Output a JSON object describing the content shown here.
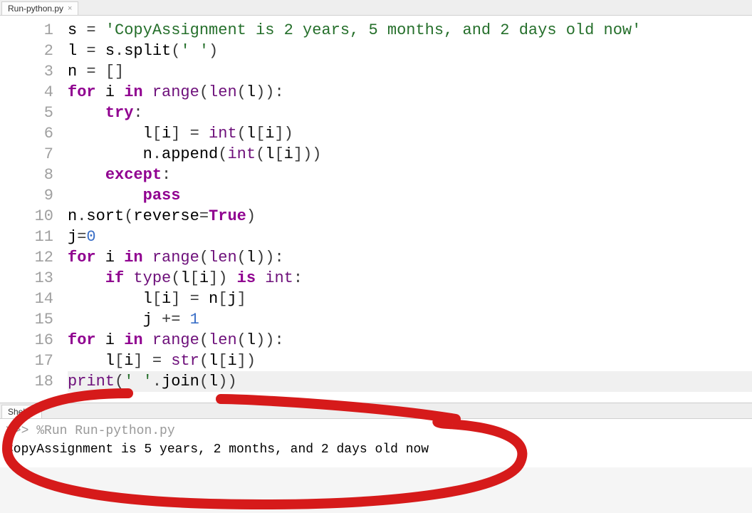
{
  "editor": {
    "tab_label": "Run-python.py",
    "lines": [
      {
        "n": 1,
        "tokens": [
          [
            "id",
            "s "
          ],
          [
            "op",
            "= "
          ],
          [
            "str",
            "'CopyAssignment is 2 years, 5 months, and 2 days old now'"
          ]
        ]
      },
      {
        "n": 2,
        "tokens": [
          [
            "id",
            "l "
          ],
          [
            "op",
            "= "
          ],
          [
            "id",
            "s"
          ],
          [
            "op",
            "."
          ],
          [
            "id",
            "split"
          ],
          [
            "paren",
            "("
          ],
          [
            "str",
            "' '"
          ],
          [
            "paren",
            ")"
          ]
        ]
      },
      {
        "n": 3,
        "tokens": [
          [
            "id",
            "n "
          ],
          [
            "op",
            "= "
          ],
          [
            "paren",
            "[]"
          ]
        ]
      },
      {
        "n": 4,
        "tokens": [
          [
            "kw",
            "for"
          ],
          [
            "id",
            " i "
          ],
          [
            "kw",
            "in"
          ],
          [
            "id",
            " "
          ],
          [
            "builtin",
            "range"
          ],
          [
            "paren",
            "("
          ],
          [
            "builtin",
            "len"
          ],
          [
            "paren",
            "("
          ],
          [
            "id",
            "l"
          ],
          [
            "paren",
            "))"
          ],
          [
            "op",
            ":"
          ]
        ]
      },
      {
        "n": 5,
        "tokens": [
          [
            "id",
            "    "
          ],
          [
            "kw",
            "try"
          ],
          [
            "op",
            ":"
          ]
        ]
      },
      {
        "n": 6,
        "tokens": [
          [
            "id",
            "        l"
          ],
          [
            "paren",
            "["
          ],
          [
            "id",
            "i"
          ],
          [
            "paren",
            "]"
          ],
          [
            "op",
            " = "
          ],
          [
            "builtin",
            "int"
          ],
          [
            "paren",
            "("
          ],
          [
            "id",
            "l"
          ],
          [
            "paren",
            "["
          ],
          [
            "id",
            "i"
          ],
          [
            "paren",
            "])"
          ]
        ]
      },
      {
        "n": 7,
        "tokens": [
          [
            "id",
            "        n"
          ],
          [
            "op",
            "."
          ],
          [
            "id",
            "append"
          ],
          [
            "paren",
            "("
          ],
          [
            "builtin",
            "int"
          ],
          [
            "paren",
            "("
          ],
          [
            "id",
            "l"
          ],
          [
            "paren",
            "["
          ],
          [
            "id",
            "i"
          ],
          [
            "paren",
            "]))"
          ]
        ]
      },
      {
        "n": 8,
        "tokens": [
          [
            "id",
            "    "
          ],
          [
            "kw",
            "except"
          ],
          [
            "op",
            ":"
          ]
        ]
      },
      {
        "n": 9,
        "tokens": [
          [
            "id",
            "        "
          ],
          [
            "kw",
            "pass"
          ]
        ]
      },
      {
        "n": 10,
        "tokens": [
          [
            "id",
            "n"
          ],
          [
            "op",
            "."
          ],
          [
            "id",
            "sort"
          ],
          [
            "paren",
            "("
          ],
          [
            "id",
            "reverse"
          ],
          [
            "op",
            "="
          ],
          [
            "bool",
            "True"
          ],
          [
            "paren",
            ")"
          ]
        ]
      },
      {
        "n": 11,
        "tokens": [
          [
            "id",
            "j"
          ],
          [
            "op",
            "="
          ],
          [
            "num",
            "0"
          ]
        ]
      },
      {
        "n": 12,
        "tokens": [
          [
            "kw",
            "for"
          ],
          [
            "id",
            " i "
          ],
          [
            "kw",
            "in"
          ],
          [
            "id",
            " "
          ],
          [
            "builtin",
            "range"
          ],
          [
            "paren",
            "("
          ],
          [
            "builtin",
            "len"
          ],
          [
            "paren",
            "("
          ],
          [
            "id",
            "l"
          ],
          [
            "paren",
            "))"
          ],
          [
            "op",
            ":"
          ]
        ]
      },
      {
        "n": 13,
        "tokens": [
          [
            "id",
            "    "
          ],
          [
            "kw",
            "if"
          ],
          [
            "id",
            " "
          ],
          [
            "builtin",
            "type"
          ],
          [
            "paren",
            "("
          ],
          [
            "id",
            "l"
          ],
          [
            "paren",
            "["
          ],
          [
            "id",
            "i"
          ],
          [
            "paren",
            "])"
          ],
          [
            "id",
            " "
          ],
          [
            "kw",
            "is"
          ],
          [
            "id",
            " "
          ],
          [
            "builtin",
            "int"
          ],
          [
            "op",
            ":"
          ]
        ]
      },
      {
        "n": 14,
        "tokens": [
          [
            "id",
            "        l"
          ],
          [
            "paren",
            "["
          ],
          [
            "id",
            "i"
          ],
          [
            "paren",
            "]"
          ],
          [
            "op",
            " = "
          ],
          [
            "id",
            "n"
          ],
          [
            "paren",
            "["
          ],
          [
            "id",
            "j"
          ],
          [
            "paren",
            "]"
          ]
        ]
      },
      {
        "n": 15,
        "tokens": [
          [
            "id",
            "        j "
          ],
          [
            "op",
            "+= "
          ],
          [
            "num",
            "1"
          ]
        ]
      },
      {
        "n": 16,
        "tokens": [
          [
            "kw",
            "for"
          ],
          [
            "id",
            " i "
          ],
          [
            "kw",
            "in"
          ],
          [
            "id",
            " "
          ],
          [
            "builtin",
            "range"
          ],
          [
            "paren",
            "("
          ],
          [
            "builtin",
            "len"
          ],
          [
            "paren",
            "("
          ],
          [
            "id",
            "l"
          ],
          [
            "paren",
            "))"
          ],
          [
            "op",
            ":"
          ]
        ]
      },
      {
        "n": 17,
        "tokens": [
          [
            "id",
            "    l"
          ],
          [
            "paren",
            "["
          ],
          [
            "id",
            "i"
          ],
          [
            "paren",
            "]"
          ],
          [
            "op",
            " = "
          ],
          [
            "builtin",
            "str"
          ],
          [
            "paren",
            "("
          ],
          [
            "id",
            "l"
          ],
          [
            "paren",
            "["
          ],
          [
            "id",
            "i"
          ],
          [
            "paren",
            "])"
          ]
        ]
      },
      {
        "n": 18,
        "hl": true,
        "tokens": [
          [
            "builtin",
            "print"
          ],
          [
            "paren",
            "("
          ],
          [
            "str",
            "' '"
          ],
          [
            "op",
            "."
          ],
          [
            "id",
            "join"
          ],
          [
            "paren",
            "("
          ],
          [
            "id",
            "l"
          ],
          [
            "paren",
            "))"
          ]
        ]
      }
    ]
  },
  "shell": {
    "tab_label": "Shell",
    "prompt": ">>> ",
    "command": "%Run Run-python.py",
    "output": "CopyAssignment is 5 years, 2 months, and 2 days old now"
  }
}
